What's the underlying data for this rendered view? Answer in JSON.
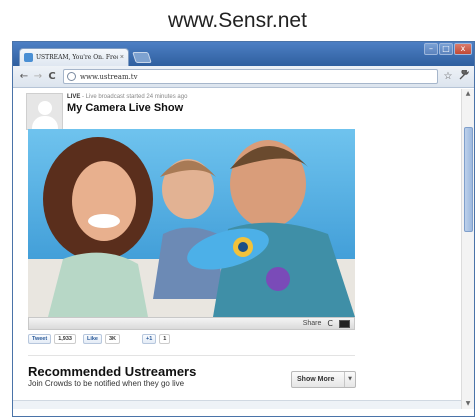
{
  "site": {
    "title": "www.Sensr.net"
  },
  "browser": {
    "tab_title": "USTREAM, You're On. Free L",
    "tab_close": "×",
    "url": "www.ustream.tv",
    "window_buttons": {
      "minimize": "–",
      "maximize": "□",
      "close": "x"
    },
    "icons": {
      "back": "←",
      "forward": "→",
      "reload": "C",
      "star": "☆",
      "wrench": "🔧"
    }
  },
  "broadcast": {
    "live_label": "LIVE",
    "live_status": " - Live broadcast started 24 minutes ago",
    "title": "My Camera Live Show"
  },
  "video_controls": {
    "share_label": "Share",
    "refresh_icon": "C"
  },
  "social": {
    "tweet_label": "Tweet",
    "tweet_count": "1,933",
    "like_label": "Like",
    "like_count": "3K",
    "plus_label": "+1",
    "plus_count": "1"
  },
  "recommended": {
    "title": "Recommended Ustreamers",
    "subtitle": "Join Crowds to be notified when they go live",
    "show_more_label": "Show More",
    "show_more_caret": "▼"
  },
  "scrollbar": {
    "up": "▲",
    "down": "▼"
  }
}
